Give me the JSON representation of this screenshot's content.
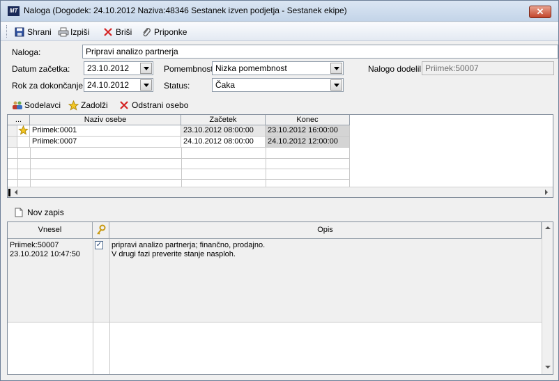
{
  "window": {
    "title": "Naloga (Dogodek: 24.10.2012 Naziva:48346 Sestanek izven podjetja - Sestanek ekipe)",
    "app_icon_text": "MT",
    "close_label": "✕"
  },
  "toolbar": {
    "save_label": "Shrani",
    "print_label": "Izpiši",
    "delete_label": "Briši",
    "attachments_label": "Priponke"
  },
  "form": {
    "task_label": "Naloga:",
    "task_value": "Pripravi analizo partnerja",
    "start_date_label": "Datum začetka:",
    "start_date_value": "23.10.2012",
    "priority_label": "Pomembnost:",
    "priority_value": "Nizka pomembnost",
    "assigned_by_label": "Nalogo dodelil:",
    "assigned_by_value": "Priimek:50007",
    "due_date_label": "Rok za dokončanje:",
    "due_date_value": "24.10.2012",
    "status_label": "Status:",
    "status_value": "Čaka"
  },
  "people_toolbar": {
    "collaborators_label": "Sodelavci",
    "assign_label": "Zadolži",
    "remove_label": "Odstrani osebo"
  },
  "people_grid": {
    "columns": [
      "...",
      "Naziv osebe",
      "Začetek",
      "Konec"
    ],
    "rows": [
      {
        "name": "Priimek:0001",
        "start": "23.10.2012 08:00:00",
        "end": "23.10.2012 16:00:00"
      },
      {
        "name": "Priimek:0007",
        "start": "24.10.2012 08:00:00",
        "end": "24.10.2012 12:00:00"
      }
    ]
  },
  "notes": {
    "new_entry_label": "Nov zapis",
    "columns": {
      "author": "Vnesel",
      "description": "Opis"
    },
    "entry": {
      "author": "Priimek:50007",
      "timestamp": "23.10.2012 10:47:50",
      "checked": "✓",
      "line1": "pripravi analizo partnerja; finančno, prodajno.",
      "line2": "V drugi fazi preverite stanje nasploh."
    }
  },
  "colors": {
    "titlebar": "#c3d4e8",
    "close_button": "#c3452c",
    "delete_icon": "#d42020",
    "remove_icon": "#d42020"
  }
}
